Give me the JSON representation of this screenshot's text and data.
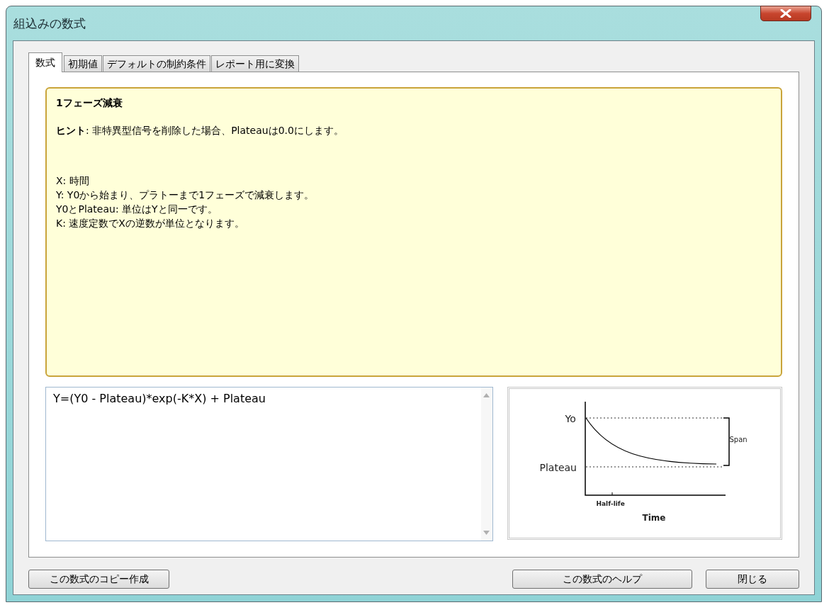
{
  "window": {
    "title": "組込みの数式"
  },
  "tabs": [
    {
      "label": "数式",
      "selected": true
    },
    {
      "label": "初期値",
      "selected": false
    },
    {
      "label": "デフォルトの制約条件",
      "selected": false
    },
    {
      "label": "レポート用に変換",
      "selected": false
    }
  ],
  "description": {
    "title": "1フェーズ減衰",
    "hint": "**ヒント**: 非特異型信号を削除した場合、Plateauは0.0にします。",
    "lines": [
      "X: 時間",
      "Y: Y0から始まり、プラトーまで1フェーズで減衰します。",
      "Y0とPlateau: 単位はYと同一です。",
      "K: 速度定数でXの逆数が単位となります。"
    ]
  },
  "formula": {
    "value": "Y=(Y0 - Plateau)*exp(-K*X) + Plateau"
  },
  "diagram": {
    "y_top_label": "Yo",
    "y_bottom_label": "Plateau",
    "span_label": "Span",
    "x_tick_label": "Half-life",
    "x_label": "Time"
  },
  "buttons": [
    {
      "label": "この数式のコピー作成",
      "kind": "left"
    },
    {
      "label": "この数式のヘルプ",
      "kind": "right-wide"
    },
    {
      "label": "閉じる",
      "kind": "right"
    }
  ]
}
